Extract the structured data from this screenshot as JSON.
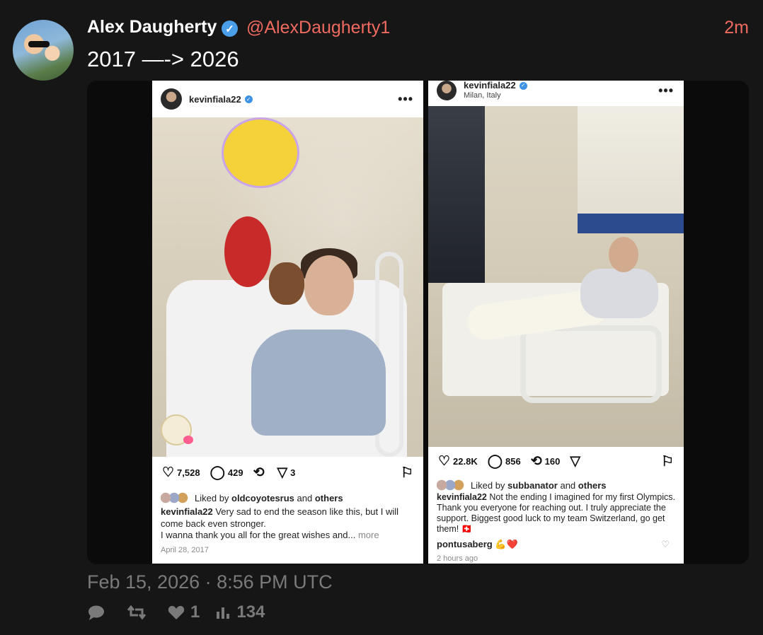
{
  "tweet": {
    "author_name": "Alex Daugherty",
    "handle": "@AlexDaugherty1",
    "time_ago": "2m",
    "text": "2017 —-> 2026",
    "date": "Feb 15, 2026 · 8:56 PM UTC",
    "stats": {
      "retweets": "",
      "likes": "1",
      "views": "134"
    }
  },
  "post_left": {
    "username": "kevinfiala22",
    "likes": "7,528",
    "comments": "429",
    "shares": "3",
    "liked_by_prefix": "Liked by",
    "liked_by_user": "oldcoyotesrus",
    "liked_by_and": "and",
    "liked_by_others": "others",
    "caption_user": "kevinfiala22",
    "caption_line1": " Very sad to end the season like this, but I will come back even stronger.",
    "caption_line2": "I wanna thank you all for the great wishes and...",
    "caption_more": "more",
    "date": "April 28, 2017"
  },
  "post_right": {
    "username": "kevinfiala22",
    "location": "Milan, Italy",
    "likes": "22.8K",
    "comments": "856",
    "reposts": "160",
    "liked_by_prefix": "Liked by",
    "liked_by_user": "subbanator",
    "liked_by_and": "and",
    "liked_by_others": "others",
    "caption_user": "kevinfiala22",
    "caption_text": " Not the ending I imagined for my first Olympics. Thank you everyone for reaching out. I truly appreciate the support. Biggest good luck to my team Switzerland, go get them! 🇨🇭",
    "comment_user": "pontusaberg",
    "comment_emoji": "💪❤️",
    "time_ago": "2 hours ago"
  },
  "colors": {
    "background": "#161616",
    "handle": "#ef6a5f",
    "verified": "#4a9fe8",
    "muted": "#7a7a7a"
  }
}
